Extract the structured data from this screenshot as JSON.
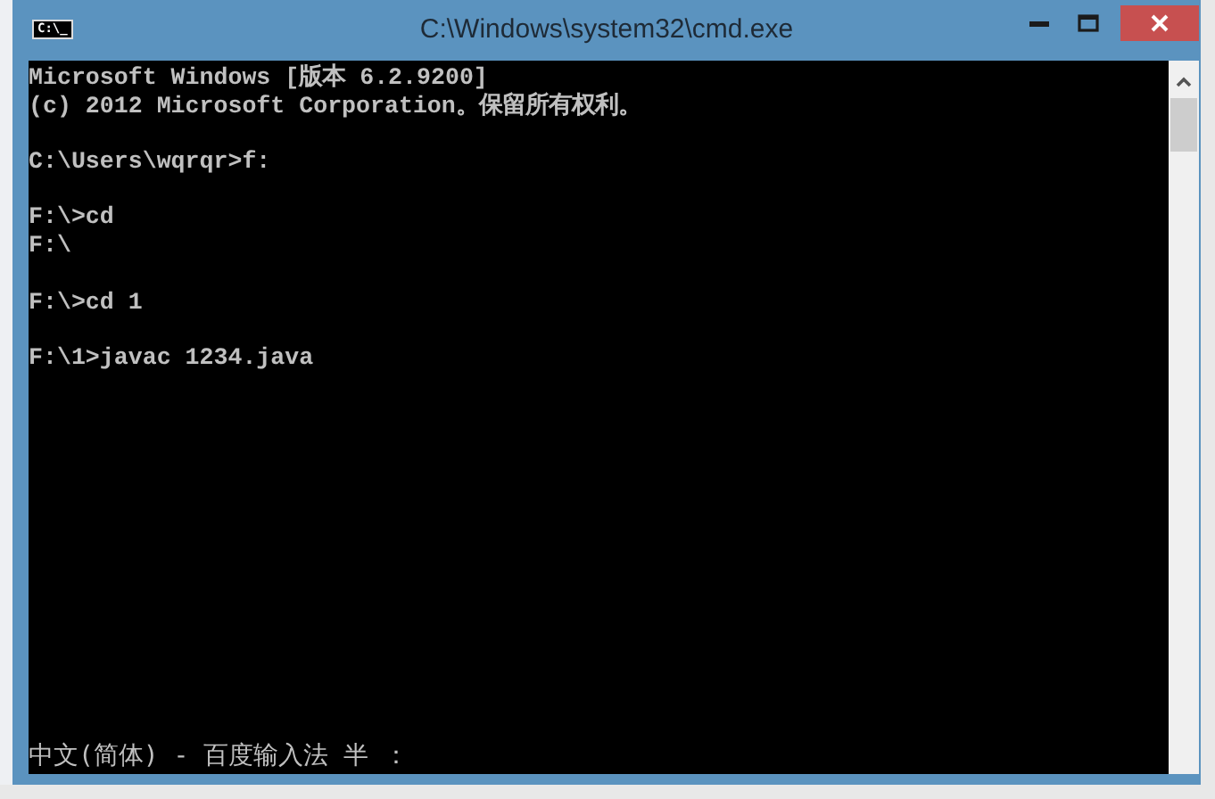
{
  "window": {
    "title": "C:\\Windows\\system32\\cmd.exe",
    "icon_text": "C:\\_"
  },
  "console": {
    "blocks": [
      {
        "lines": [
          "Microsoft Windows [版本 6.2.9200]",
          "(c) 2012 Microsoft Corporation。保留所有权利。"
        ]
      },
      {
        "lines": [
          "C:\\Users\\wqrqr>f:"
        ]
      },
      {
        "lines": [
          "F:\\>cd",
          "F:\\"
        ]
      },
      {
        "lines": [
          "F:\\>cd 1"
        ]
      },
      {
        "lines": [
          "F:\\1>javac 1234.java"
        ]
      }
    ],
    "ime_status": "中文(简体) - 百度输入法 半 ："
  }
}
